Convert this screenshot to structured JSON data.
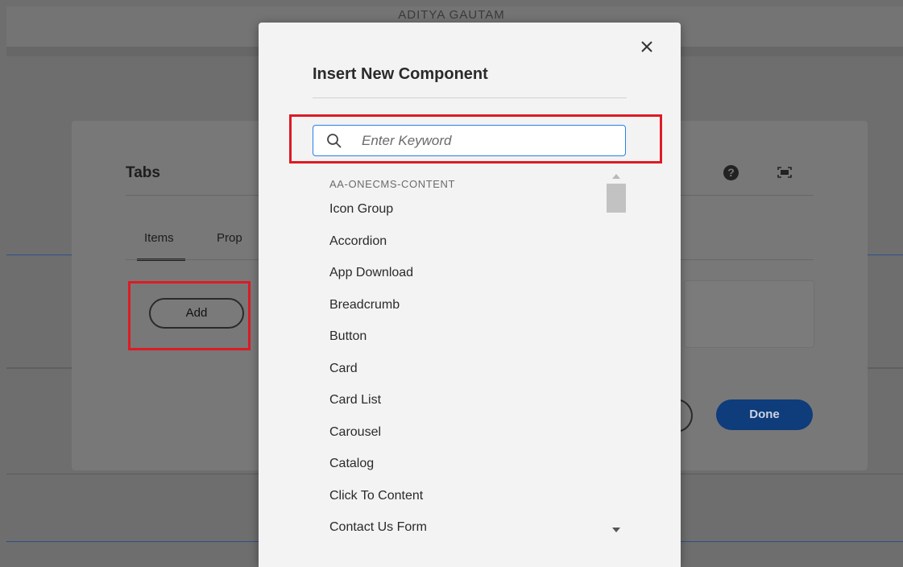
{
  "page": {
    "user_name": "ADITYA GAUTAM"
  },
  "tabs_dialog": {
    "title": "Tabs",
    "help_icon": "?",
    "tabs": [
      "Items",
      "Prop"
    ],
    "add_label": "Add",
    "done_label": "Done"
  },
  "modal": {
    "title": "Insert New Component",
    "close_icon": "close-icon",
    "search": {
      "placeholder": "Enter Keyword",
      "value": ""
    },
    "group_header": "AA-ONECMS-CONTENT",
    "items": [
      "Icon Group",
      "Accordion",
      "App Download",
      "Breadcrumb",
      "Button",
      "Card",
      "Card List",
      "Carousel",
      "Catalog",
      "Click To Content",
      "Contact Us Form"
    ]
  },
  "colors": {
    "highlight": "#dd1b24",
    "primary_button": "#0f3c7a",
    "focus_border": "#2680eb"
  }
}
